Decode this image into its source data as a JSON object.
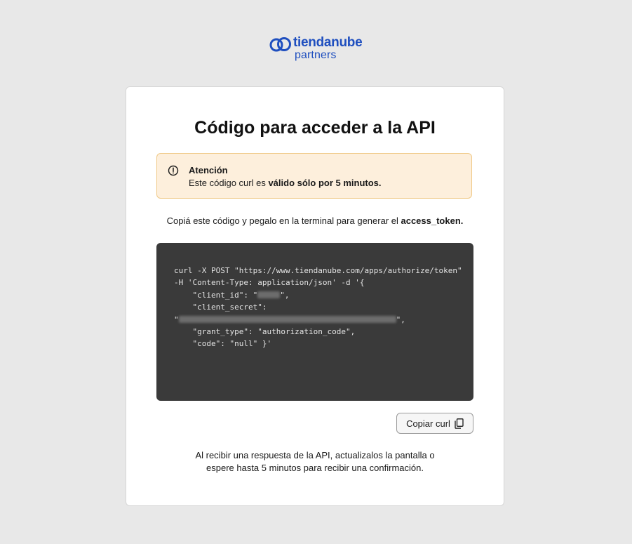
{
  "logo": {
    "brand": "tiendanube",
    "sub": "partners",
    "color": "#1f4fbf"
  },
  "card": {
    "title": "Código para acceder a la API"
  },
  "alert": {
    "icon": "alert-circle-icon",
    "title": "Atención",
    "body_prefix": "Este código curl es ",
    "body_bold": "válido sólo por 5 minutos."
  },
  "instruction": {
    "prefix": "Copiá este código y pegalo en la terminal para generar el ",
    "bold": "access_token."
  },
  "code": {
    "line1": "curl -X POST \"https://www.tiendanube.com/apps/authorize/token\"",
    "line2": "-H 'Content-Type: application/json' -d '{",
    "client_id_prefix": "    \"client_id\": \"",
    "client_id_suffix": "\",",
    "client_secret_label": "    \"client_secret\":",
    "client_secret_open": "\"",
    "client_secret_close": "\",",
    "grant_type": "    \"grant_type\": \"authorization_code\",",
    "code_line": "    \"code\": \"null\" }'"
  },
  "copy_button": {
    "label": "Copiar curl",
    "icon": "copy-icon"
  },
  "footer": {
    "line1": "Al recibir una respuesta de la API, actualizalos la pantalla o",
    "line2": "espere hasta 5 minutos para recibir una confirmación."
  }
}
